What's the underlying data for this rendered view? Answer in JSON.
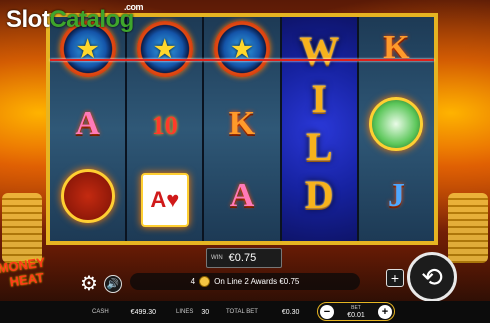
{
  "watermark": {
    "slot": "Slot",
    "catalog": "Catalog",
    "com": ".com"
  },
  "game_logo": {
    "line1": "MONEY",
    "line2": "HEAT"
  },
  "reels": [
    {
      "symbols": [
        "badge-star",
        "letter-A",
        "fire-chip"
      ],
      "letter": "A"
    },
    {
      "symbols": [
        "badge-star",
        "ten",
        "playing-cards"
      ],
      "ten": "10",
      "card": "A♥"
    },
    {
      "symbols": [
        "badge-star",
        "letter-K",
        "letter-A"
      ],
      "k": "K",
      "a": "A"
    },
    {
      "symbols": [
        "wild"
      ],
      "wild_letters": [
        "W",
        "I",
        "L",
        "D"
      ]
    },
    {
      "symbols": [
        "letter-K",
        "cash-money",
        "letter-J"
      ],
      "k": "K",
      "j": "J"
    }
  ],
  "icons": {
    "star": "★",
    "gear": "⚙",
    "sound": "🔊",
    "plus": "+",
    "spin": "⟲",
    "minus": "−"
  },
  "win": {
    "label": "WIN",
    "value": "€0.75"
  },
  "info": {
    "line_no": "4",
    "message": "On Line 2 Awards €0.75"
  },
  "bottom_bar": {
    "cash_label": "CASH",
    "cash_value": "€499.30",
    "lines_label": "LINES",
    "lines_value": "30",
    "total_bet_label": "TOTAL BET",
    "total_bet_value": "€0.30"
  },
  "bet": {
    "label": "BET",
    "value": "€0.01"
  },
  "colors": {
    "frame": "#e6b422",
    "payline": "#e0201a",
    "wild_reel": "#1622a0"
  }
}
